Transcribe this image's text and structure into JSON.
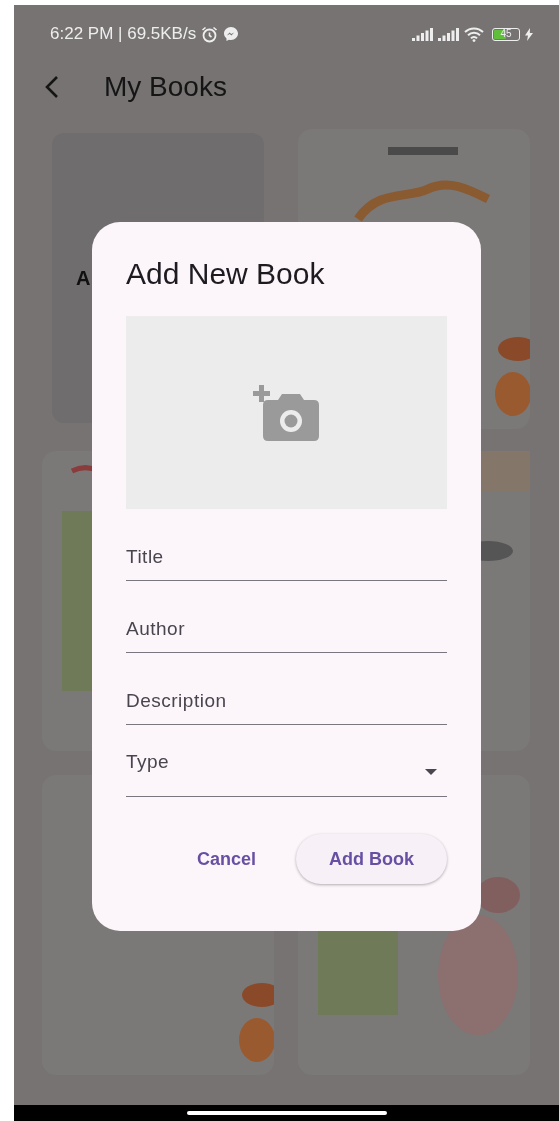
{
  "status_bar": {
    "time": "6:22 PM | 69.5KB/s",
    "battery": "45"
  },
  "app_bar": {
    "title": "My Books"
  },
  "books": [
    {
      "kind": "text",
      "title": "A"
    },
    {
      "kind": "picture"
    },
    {
      "kind": "picture"
    },
    {
      "kind": "picture"
    },
    {
      "kind": "picture"
    },
    {
      "kind": "picture"
    }
  ],
  "dialog": {
    "title": "Add New Book",
    "fields": [
      {
        "kind": "text",
        "placeholder": "Title"
      },
      {
        "kind": "text",
        "placeholder": "Author"
      },
      {
        "kind": "text",
        "placeholder": "Description"
      },
      {
        "kind": "dropdown",
        "placeholder": "Type"
      }
    ],
    "buttons": [
      {
        "kind": "text",
        "label": "Cancel"
      },
      {
        "kind": "elevated",
        "label": "Add Book"
      }
    ]
  }
}
